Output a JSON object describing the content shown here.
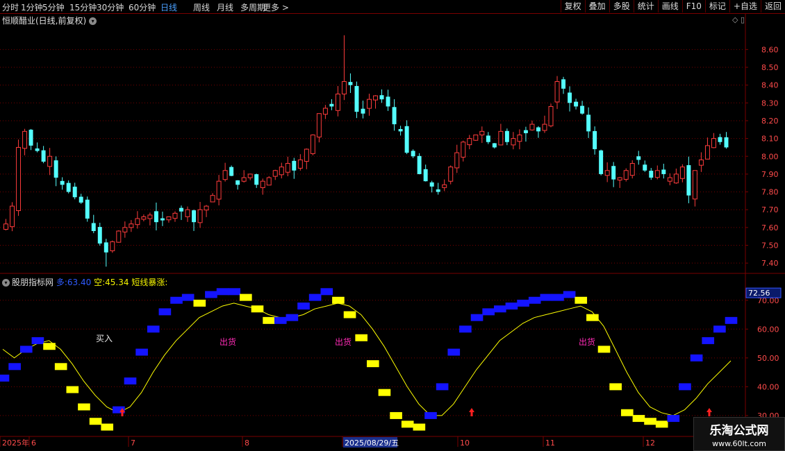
{
  "toolbar": {
    "periods": [
      {
        "label": "分时",
        "active": false
      },
      {
        "label": "1分钟",
        "active": false
      },
      {
        "label": "5分钟",
        "active": false
      },
      {
        "label": "15分钟",
        "active": false
      },
      {
        "label": "30分钟",
        "active": false
      },
      {
        "label": "60分钟",
        "active": false
      },
      {
        "label": "日线",
        "active": true
      },
      {
        "label": "周线",
        "active": false
      },
      {
        "label": "月线",
        "active": false
      },
      {
        "label": "多周期",
        "active": false
      },
      {
        "label": "更多 >",
        "active": false
      }
    ],
    "actions": [
      "复权",
      "叠加",
      "多股",
      "统计",
      "画线",
      "F10",
      "标记",
      "+自选",
      "返回"
    ]
  },
  "stock": {
    "title": "恒顺醋业(日线,前复权)",
    "price_axis": [
      "8.60",
      "8.50",
      "8.40",
      "8.30",
      "8.20",
      "8.10",
      "8.00",
      "7.90",
      "7.80",
      "7.70",
      "7.60",
      "7.50",
      "7.40"
    ]
  },
  "indicator": {
    "name": "股朋指标网",
    "duo_label": "多:",
    "duo_value": "63.40",
    "kong_label": "空:",
    "kong_value": "45.34",
    "signal_label": "短线暴涨:",
    "axis": [
      "70.00",
      "60.00",
      "50.00",
      "40.00",
      "30.00"
    ],
    "current_value": "72.56",
    "annotations": [
      {
        "text": "买入",
        "color": "#e8e8e8",
        "anchor": "buy"
      },
      {
        "text": "出货",
        "color": "#ff2bb6",
        "anchor": "sell1"
      },
      {
        "text": "出货",
        "color": "#ff2bb6",
        "anchor": "sell2"
      },
      {
        "text": "出货",
        "color": "#ff2bb6",
        "anchor": "sell3"
      }
    ]
  },
  "time_axis": {
    "labels": [
      "2025年",
      "6",
      "7",
      "8",
      "2025/08/29/五",
      "10",
      "11",
      "12"
    ]
  },
  "colors": {
    "up": "#ff3c3c",
    "down": "#54ffff",
    "duo": "#1414ff",
    "kong": "#ffff00",
    "grid": "#7a0000",
    "arrow": "#ff2020"
  },
  "watermark": {
    "line1": "乐淘公式网",
    "line2": "www.60lt.com"
  },
  "chart_data": [
    {
      "type": "candlestick",
      "title": "恒顺醋业(日线,前复权)",
      "ylim": [
        7.35,
        8.73
      ],
      "y_ticks": [
        7.4,
        7.5,
        7.6,
        7.7,
        7.8,
        7.9,
        8.0,
        8.1,
        8.2,
        8.3,
        8.4,
        8.5,
        8.6
      ],
      "x_ticks": [
        "2025年",
        "6",
        "7",
        "8",
        "2025/08/29/五",
        "10",
        "11",
        "12"
      ],
      "close": [
        7.62,
        7.72,
        8.05,
        8.14,
        8.06,
        8.03,
        7.97,
        8.0,
        7.88,
        7.84,
        7.8,
        7.77,
        7.74,
        7.65,
        7.58,
        7.51,
        7.46,
        7.52,
        7.58,
        7.6,
        7.62,
        7.65,
        7.66,
        7.67,
        7.63,
        7.64,
        7.66,
        7.68,
        7.69,
        7.7,
        7.63,
        7.7,
        7.72,
        7.78,
        7.86,
        7.92,
        7.89,
        7.84,
        7.88,
        7.9,
        7.84,
        7.86,
        7.88,
        7.92,
        7.94,
        7.96,
        7.92,
        7.98,
        8.04,
        8.12,
        8.24,
        8.27,
        8.28,
        8.35,
        8.42,
        8.4,
        8.25,
        8.24,
        8.32,
        8.34,
        8.32,
        8.28,
        8.18,
        8.14,
        8.02,
        8.0,
        7.9,
        7.86,
        7.83,
        7.8,
        7.84,
        7.94,
        8.02,
        8.08,
        8.1,
        8.12,
        8.14,
        8.08,
        8.05,
        8.14,
        8.08,
        8.1,
        8.12,
        8.13,
        8.18,
        8.14,
        8.18,
        8.28,
        8.42,
        8.38,
        8.3,
        8.28,
        8.24,
        8.14,
        8.04,
        7.9,
        7.92,
        7.87,
        7.88,
        7.92,
        7.96,
        7.98,
        7.92,
        7.88,
        7.92,
        7.9,
        7.88,
        7.9,
        7.94,
        7.78,
        7.92,
        7.98,
        8.06,
        8.1,
        8.08,
        8.05
      ],
      "high_max": 8.68,
      "low_min": 7.38
    },
    {
      "type": "line",
      "title": "股朋指标网",
      "ylim": [
        23,
        75
      ],
      "y_ticks": [
        30,
        40,
        50,
        60,
        70
      ],
      "series": [
        {
          "name": "多",
          "values": [
            43,
            47,
            53,
            56,
            54,
            47,
            39,
            33,
            28,
            26,
            32,
            42,
            52,
            60,
            66,
            70,
            71,
            69,
            72,
            73,
            73,
            71,
            67,
            63,
            63,
            64,
            68,
            71,
            73,
            70,
            65,
            57,
            48,
            38,
            30,
            27,
            26,
            30,
            40,
            52,
            60,
            64,
            66,
            67,
            68,
            69,
            70,
            71,
            71,
            72,
            70,
            64,
            53,
            40,
            31,
            29,
            28,
            27,
            29,
            40,
            50,
            56,
            60,
            63
          ]
        },
        {
          "name": "空",
          "values": [
            53,
            50,
            53,
            55,
            56,
            53,
            48,
            42,
            37,
            33,
            31,
            33,
            38,
            45,
            51,
            56,
            60,
            64,
            66,
            68,
            69,
            68,
            67,
            65,
            64,
            64,
            65,
            67,
            68,
            69,
            68,
            65,
            60,
            54,
            47,
            40,
            34,
            30,
            30,
            34,
            40,
            46,
            51,
            56,
            59,
            62,
            64,
            65,
            66,
            67,
            68,
            66,
            61,
            53,
            45,
            38,
            33,
            31,
            30,
            32,
            36,
            41,
            45,
            49
          ]
        }
      ]
    }
  ]
}
